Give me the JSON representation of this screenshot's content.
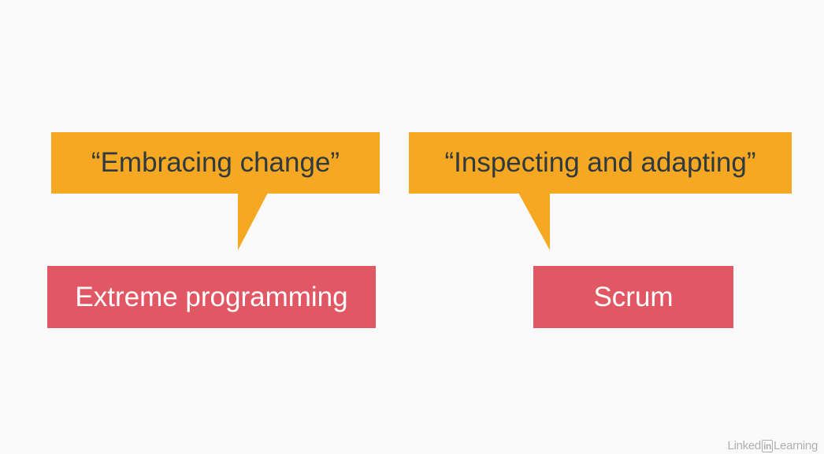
{
  "slide": {
    "left_group": {
      "quote": "“Embracing change”",
      "term": "Extreme programming"
    },
    "right_group": {
      "quote": "“Inspecting and adapting”",
      "term": "Scrum"
    }
  },
  "watermark": {
    "prefix": "Linked",
    "badge": "in",
    "suffix": "Learning"
  },
  "colors": {
    "background": "#fafafa",
    "bubble": "#f7a823",
    "bubble_text": "#2e3a3f",
    "term_box": "#e15763",
    "term_text": "#ffffff"
  }
}
